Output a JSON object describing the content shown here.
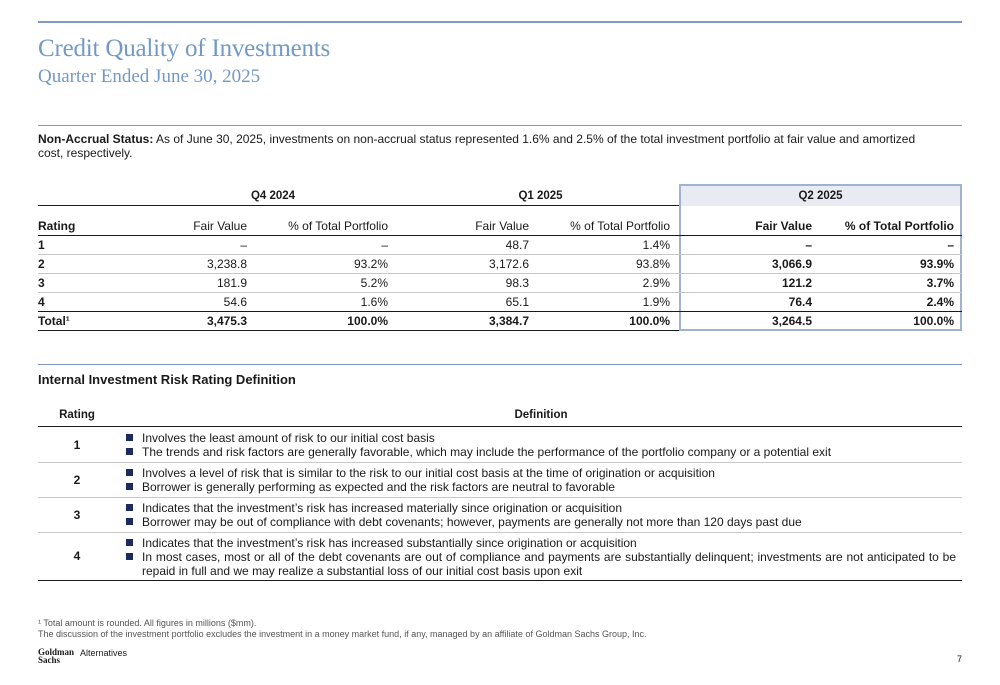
{
  "header": {
    "title": "Credit Quality of Investments",
    "subtitle": "Quarter Ended June 30, 2025"
  },
  "note": {
    "label": "Non-Accrual Status:",
    "text": " As of June 30, 2025, investments on non-accrual status represented 1.6% and 2.5% of the total investment portfolio at fair value and amortized cost, respectively."
  },
  "credit_table": {
    "groups": [
      "Q4 2024",
      "Q1 2025",
      "Q2 2025"
    ],
    "columns": [
      "Rating",
      "Fair Value",
      "% of Total Portfolio",
      "Fair Value",
      "% of Total Portfolio",
      "Fair Value",
      "% of Total Portfolio"
    ],
    "rows": [
      [
        "1",
        "–",
        "–",
        "48.7",
        "1.4%",
        "–",
        "–"
      ],
      [
        "2",
        "3,238.8",
        "93.2%",
        "3,172.6",
        "93.8%",
        "3,066.9",
        "93.9%"
      ],
      [
        "3",
        "181.9",
        "5.2%",
        "98.3",
        "2.9%",
        "121.2",
        "3.7%"
      ],
      [
        "4",
        "54.6",
        "1.6%",
        "65.1",
        "1.9%",
        "76.4",
        "2.4%"
      ],
      [
        "Total¹",
        "3,475.3",
        "100.0%",
        "3,384.7",
        "100.0%",
        "3,264.5",
        "100.0%"
      ]
    ]
  },
  "definitions": {
    "title": "Internal Investment Risk Rating Definition",
    "col_rating": "Rating",
    "col_definition": "Definition",
    "rows": [
      {
        "rating": "1",
        "bullets": [
          "Involves the least amount of risk to our initial cost basis",
          "The trends and risk factors are generally favorable, which may include the performance of the portfolio company or a potential exit"
        ]
      },
      {
        "rating": "2",
        "bullets": [
          "Involves a level of risk that is similar to the risk to our initial cost basis at the time of origination or acquisition",
          "Borrower is generally performing as expected and the risk factors are neutral to favorable"
        ]
      },
      {
        "rating": "3",
        "bullets": [
          "Indicates that the investment’s risk has increased materially since origination or acquisition",
          "Borrower may be out of compliance with debt covenants; however, payments are generally not more than 120 days past due"
        ]
      },
      {
        "rating": "4",
        "bullets": [
          "Indicates that the investment’s risk has increased substantially since origination or acquisition",
          "In most cases, most or all of the debt covenants are out of compliance and payments are substantially delinquent; investments are not anticipated to be repaid in full and we may realize a substantial loss of our initial cost basis upon exit"
        ]
      }
    ]
  },
  "footnotes": {
    "line1": "¹ Total amount is rounded. All figures in millions ($mm).",
    "line2": "The discussion of the investment portfolio excludes the investment in a money market fund, if any, managed by an affiliate of Goldman Sachs Group, Inc."
  },
  "footer": {
    "logo_line1": "Goldman",
    "logo_line2": "Sachs",
    "logo_sub": "Alternatives",
    "page": "7"
  },
  "colors": {
    "accent": "#7399c6",
    "rule": "#7f9bc3",
    "bullet": "#1d2b5c",
    "q2_bg": "#e8ecf2"
  }
}
